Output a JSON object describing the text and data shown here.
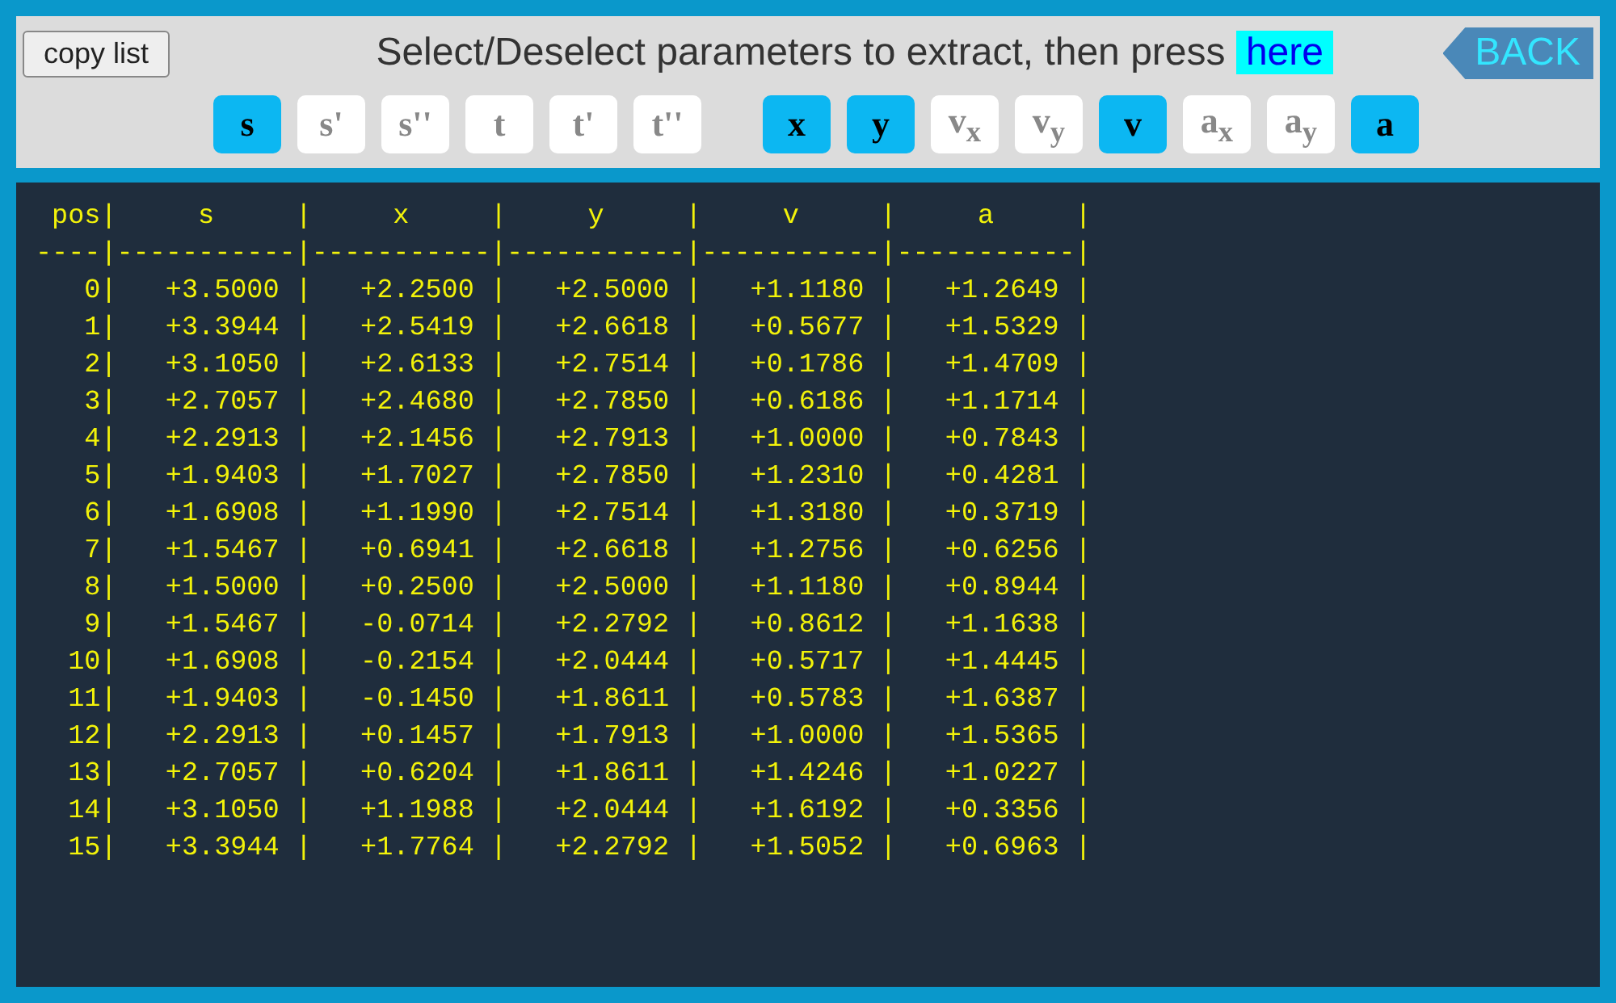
{
  "copy_button": "copy list",
  "instruction": {
    "text": "Select/Deselect parameters to extract, then press",
    "link": "here"
  },
  "back_button": "BACK",
  "parameter_groups": [
    [
      {
        "label": "s",
        "selected": true
      },
      {
        "label": "s'",
        "selected": false
      },
      {
        "label": "s''",
        "selected": false
      },
      {
        "label": "t",
        "selected": false
      },
      {
        "label": "t'",
        "selected": false
      },
      {
        "label": "t''",
        "selected": false
      }
    ],
    [
      {
        "label": "x",
        "selected": true
      },
      {
        "label": "y",
        "selected": true
      },
      {
        "label": "v$_{x}$",
        "selected": false
      },
      {
        "label": "v$_{y}$",
        "selected": false
      },
      {
        "label": "v",
        "selected": true
      },
      {
        "label": "a$_{x}$",
        "selected": false
      },
      {
        "label": "a$_{y}$",
        "selected": false
      },
      {
        "label": "a",
        "selected": true
      }
    ]
  ],
  "output_lines": [
    " pos|     s     |     x     |     y     |     v     |     a     |",
    "----|-----------|-----------|-----------|-----------|-----------|",
    "   0|   +3.5000 |   +2.2500 |   +2.5000 |   +1.1180 |   +1.2649 |",
    "   1|   +3.3944 |   +2.5419 |   +2.6618 |   +0.5677 |   +1.5329 |",
    "   2|   +3.1050 |   +2.6133 |   +2.7514 |   +0.1786 |   +1.4709 |",
    "   3|   +2.7057 |   +2.4680 |   +2.7850 |   +0.6186 |   +1.1714 |",
    "   4|   +2.2913 |   +2.1456 |   +2.7913 |   +1.0000 |   +0.7843 |",
    "   5|   +1.9403 |   +1.7027 |   +2.7850 |   +1.2310 |   +0.4281 |",
    "   6|   +1.6908 |   +1.1990 |   +2.7514 |   +1.3180 |   +0.3719 |",
    "   7|   +1.5467 |   +0.6941 |   +2.6618 |   +1.2756 |   +0.6256 |",
    "   8|   +1.5000 |   +0.2500 |   +2.5000 |   +1.1180 |   +0.8944 |",
    "   9|   +1.5467 |   -0.0714 |   +2.2792 |   +0.8612 |   +1.1638 |",
    "  10|   +1.6908 |   -0.2154 |   +2.0444 |   +0.5717 |   +1.4445 |",
    "  11|   +1.9403 |   -0.1450 |   +1.8611 |   +0.5783 |   +1.6387 |",
    "  12|   +2.2913 |   +0.1457 |   +1.7913 |   +1.0000 |   +1.5365 |",
    "  13|   +2.7057 |   +0.6204 |   +1.8611 |   +1.4246 |   +1.0227 |",
    "  14|   +3.1050 |   +1.1988 |   +2.0444 |   +1.6192 |   +0.3356 |",
    "  15|   +3.3944 |   +1.7764 |   +2.2792 |   +1.5052 |   +0.6963 |"
  ]
}
